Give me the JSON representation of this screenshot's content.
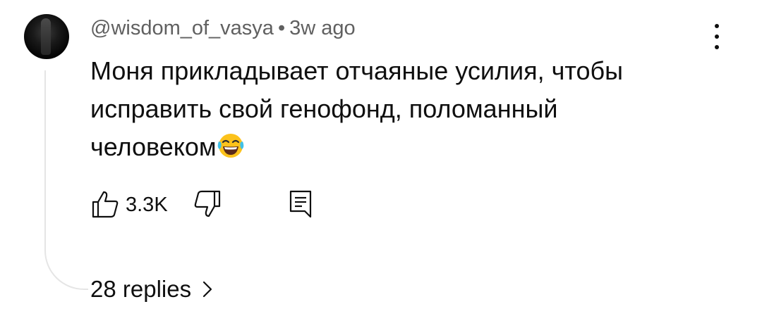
{
  "comment": {
    "author": "@wisdom_of_vasya",
    "separator": "•",
    "time": "3w ago",
    "text_lines": [
      "Моня прикладывает отчаяные усилия, чтобы",
      "исправить свой генофонд, поломанный",
      "человеком"
    ],
    "emoji": "face-with-tears-of-joy",
    "like_count": "3.3K",
    "replies_label": "28 replies"
  },
  "icons": {
    "more": "more-vert-icon",
    "like": "thumb-up-icon",
    "dislike": "thumb-down-icon",
    "reply": "comment-reply-icon",
    "chevron": "chevron-right-icon"
  },
  "colors": {
    "primary_text": "#0f0f0f",
    "secondary_text": "#606060",
    "thread_line": "#e5e5e5",
    "emoji_face": "#fcc21b",
    "emoji_tears": "#40c0e7"
  }
}
